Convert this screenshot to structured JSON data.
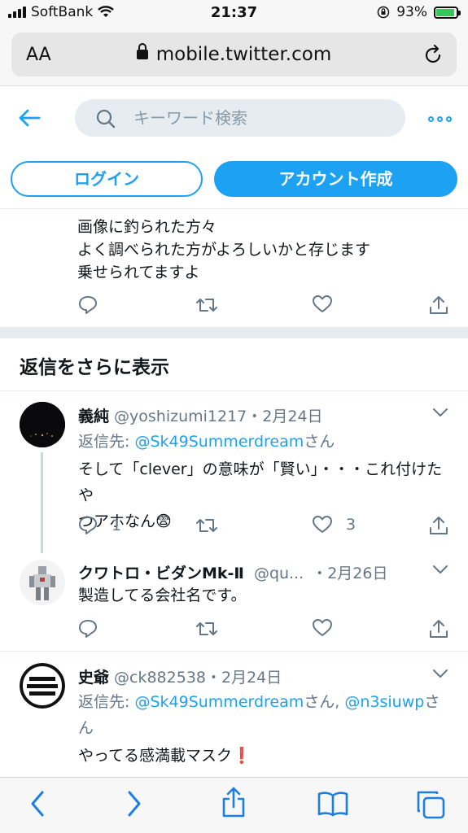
{
  "status_bar": {
    "carrier": "SoftBank",
    "time": "21:37",
    "battery": "93%"
  },
  "browser": {
    "text_size_label": "AA",
    "url": "mobile.twitter.com"
  },
  "header": {
    "search_placeholder": "キーワード検索"
  },
  "auth": {
    "login_label": "ログイン",
    "signup_label": "アカウント作成"
  },
  "top_tweet": {
    "lines": [
      "画像に釣られた方々",
      "よく調べられた方がよろしいかと存じます",
      "乗せられてますよ"
    ]
  },
  "more_replies_title": "返信をさらに表示",
  "tweets": [
    {
      "name": "義純",
      "handle": "@yoshizumi1217",
      "date": "・2月24日",
      "reply_prefix": "返信先: ",
      "reply_user": "@Sk49Summerdream",
      "reply_suffix": "さん",
      "body_line1": "そして「clever」の意味が「賢い」・・・これ付けたや",
      "body_line2": "つアホなん😨",
      "reply_count": "1",
      "like_count": "3"
    },
    {
      "name": "クワトロ・ビダンMk-Ⅱ",
      "handle": "@qu...",
      "date": "・2月26日",
      "body": "製造してる会社名です。"
    },
    {
      "name": "史爺",
      "handle": "@ck882538",
      "date": "・2月24日",
      "reply_prefix": "返信先: ",
      "reply_user": "@Sk49Summerdream",
      "reply_mid": "さん, ",
      "reply_user2": "@n3siuwp",
      "reply_suffix": "さん",
      "body": "やってる感満載マスク❗"
    }
  ],
  "colors": {
    "accent": "#1da1f2",
    "muted": "#657786",
    "divider": "#e6ecf0"
  }
}
